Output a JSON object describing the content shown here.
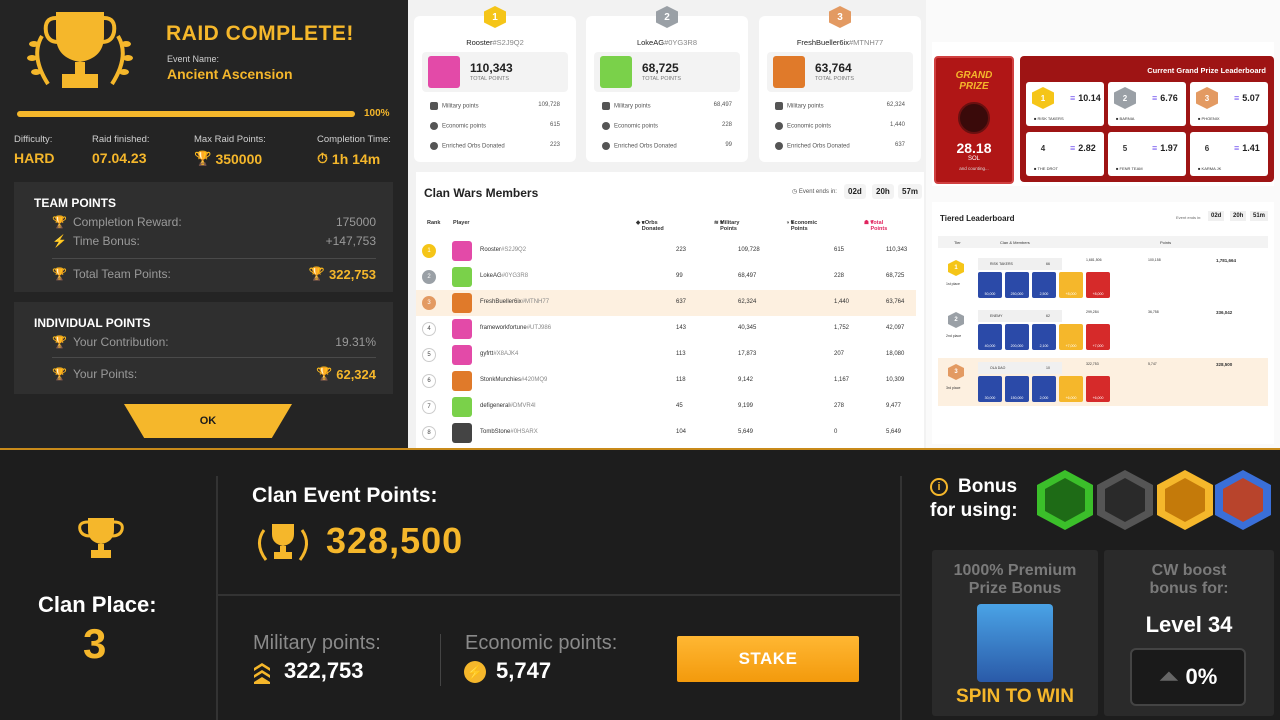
{
  "raid": {
    "title": "RAID COMPLETE!",
    "event_label": "Event Name:",
    "event_name": "Ancient Ascension",
    "progress": 1.0,
    "progress_text": "100%",
    "stats": [
      {
        "label": "Difficulty:",
        "value": "HARD"
      },
      {
        "label": "Raid finished:",
        "value": "07.04.23"
      },
      {
        "label": "Max Raid Points:",
        "value": "350000"
      },
      {
        "label": "Completion Time:",
        "value": "1h 14m"
      }
    ],
    "team": {
      "heading": "TEAM POINTS",
      "completion_label": "Completion Reward:",
      "completion_value": "175000",
      "bonus_label": "Time Bonus:",
      "bonus_value": "+147,753",
      "total_label": "Total Team Points:",
      "total_value": "322,753"
    },
    "individual": {
      "heading": "INDIVIDUAL POINTS",
      "contribution_label": "Your Contribution:",
      "contribution_value": "19.31%",
      "points_label": "Your Points:",
      "points_value": "62,324"
    },
    "ok_label": "OK"
  },
  "podium": [
    {
      "rank": "1",
      "name": "Rooster",
      "tag": "#S2J9Q2",
      "total": "110,343",
      "total_label": "TOTAL POINTS",
      "military": "109,728",
      "economic": "615",
      "orbs": "223",
      "color": "#f5c518"
    },
    {
      "rank": "2",
      "name": "LokeAG",
      "tag": "#0YG3R8",
      "total": "68,725",
      "total_label": "TOTAL POINTS",
      "military": "68,497",
      "economic": "228",
      "orbs": "99",
      "color": "#9aa0a6"
    },
    {
      "rank": "3",
      "name": "FreshBueller6ix",
      "tag": "#MTNH77",
      "total": "63,764",
      "total_label": "TOTAL POINTS",
      "military": "62,324",
      "economic": "1,440",
      "orbs": "637",
      "color": "#e39a62"
    }
  ],
  "podium_labels": {
    "military": "Military points",
    "economic": "Economic points",
    "orbs": "Enriched Orbs Donated"
  },
  "clan_wars": {
    "title": "Clan Wars Members",
    "ends_label": "Event ends in:",
    "days": "02d",
    "hours": "20h",
    "mins": "57m",
    "headers": {
      "rank": "Rank",
      "player": "Player",
      "orbs": "eOrbs Donated",
      "military": "Military Points",
      "economic": "Economic Points",
      "total": "Total Points"
    },
    "rows": [
      {
        "rank": "1",
        "name": "Rooster",
        "tag": "#S2J9Q2",
        "orbs": "223",
        "military": "109,728",
        "economic": "615",
        "total": "110,343"
      },
      {
        "rank": "2",
        "name": "LokeAG",
        "tag": "#0YG3R8",
        "orbs": "99",
        "military": "68,497",
        "economic": "228",
        "total": "68,725"
      },
      {
        "rank": "3",
        "name": "FreshBueller6ix",
        "tag": "#MTNH77",
        "orbs": "637",
        "military": "62,324",
        "economic": "1,440",
        "total": "63,764"
      },
      {
        "rank": "4",
        "name": "frameworkfortune",
        "tag": "#UTJ986",
        "orbs": "143",
        "military": "40,345",
        "economic": "1,752",
        "total": "42,097"
      },
      {
        "rank": "5",
        "name": "gyfrtt",
        "tag": "#X8AJK4",
        "orbs": "113",
        "military": "17,873",
        "economic": "207",
        "total": "18,080"
      },
      {
        "rank": "6",
        "name": "StonkMunchies",
        "tag": "#420MQ9",
        "orbs": "118",
        "military": "9,142",
        "economic": "1,167",
        "total": "10,309"
      },
      {
        "rank": "7",
        "name": "defigeneral",
        "tag": "#DMVR4I",
        "orbs": "45",
        "military": "9,199",
        "economic": "278",
        "total": "9,477"
      },
      {
        "rank": "8",
        "name": "TombStone",
        "tag": "#0HSARX",
        "orbs": "104",
        "military": "5,649",
        "economic": "0",
        "total": "5,649"
      }
    ]
  },
  "grand_prize": {
    "title_line1": "GRAND",
    "title_line2": "PRIZE",
    "amount": "28.18",
    "currency": "SOL",
    "counting": "and counting...",
    "leaderboard_title": "Current Grand Prize Leaderboard",
    "entries": [
      {
        "rank": "1",
        "value": "10.14",
        "name": "RISK TAKERS"
      },
      {
        "rank": "2",
        "value": "6.76",
        "name": "BARNIA"
      },
      {
        "rank": "3",
        "value": "5.07",
        "name": "PHOENIX"
      },
      {
        "rank": "4",
        "value": "2.82",
        "name": "THE DROT"
      },
      {
        "rank": "5",
        "value": "1.97",
        "name": "FENR TEAM"
      },
      {
        "rank": "6",
        "value": "1.41",
        "name": "KARMA JK"
      }
    ]
  },
  "tiered": {
    "title": "Tiered Leaderboard",
    "ends_label": "Event ends in:",
    "days": "02d",
    "hours": "20h",
    "mins": "51m",
    "headers": {
      "tier": "Tier",
      "clan": "Clan & Members",
      "points": "Points"
    },
    "tiers": [
      {
        "rank": "1",
        "place": "1st place",
        "clan": "RISK TAKERS",
        "members": "66",
        "p1": "1,681,506",
        "p2": "100,158",
        "total": "1,781,664",
        "tiles": [
          "50,000",
          "250,000",
          "2,500",
          "+8,000",
          "+8,000"
        ]
      },
      {
        "rank": "2",
        "place": "2nd place",
        "clan": "ENEMY",
        "members": "62",
        "p1": "299,284",
        "p2": "36,758",
        "total": "336,042",
        "tiles": [
          "40,000",
          "200,000",
          "2,100",
          "+7,000",
          "+7,000"
        ]
      },
      {
        "rank": "3",
        "place": "3rd place",
        "clan": "OLA DAO",
        "members": "10",
        "p1": "322,753",
        "p2": "5,747",
        "total": "328,500",
        "tiles": [
          "30,000",
          "150,000",
          "2,000",
          "+6,000",
          "+6,000"
        ]
      }
    ]
  },
  "bottom": {
    "clan_place_label": "Clan Place:",
    "clan_place": "3",
    "event_points_label": "Clan Event Points:",
    "event_points": "328,500",
    "military_label": "Military points:",
    "military": "322,753",
    "economic_label": "Economic points:",
    "economic": "5,747",
    "stake_label": "STAKE",
    "bonus_line1": "Bonus",
    "bonus_line2": "for using:",
    "premium_line1": "1000% Premium",
    "premium_line2": "Prize Bonus",
    "spin_label": "SPIN TO WIN",
    "boost_line1": "CW boost",
    "boost_line2": "bonus for:",
    "boost_level": "Level 34",
    "boost_value": "0%"
  },
  "colors": {
    "gold": "#f5b72b",
    "orange": "#f39a0c",
    "dark": "#1d1d1d",
    "red": "#b01616"
  }
}
